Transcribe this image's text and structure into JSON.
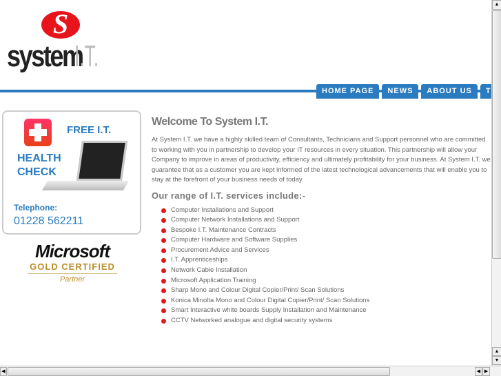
{
  "logo": {
    "mark": "S",
    "word": "system",
    "suffix": "I.T."
  },
  "nav": {
    "items": [
      {
        "label": "HOME PAGE"
      },
      {
        "label": "NEWS"
      },
      {
        "label": "ABOUT US"
      },
      {
        "label": "TEST"
      }
    ]
  },
  "promo": {
    "free": "FREE I.T.",
    "health": "HEALTH",
    "check": "CHECK",
    "telephone_label": "Telephone:",
    "telephone": "01228 562211"
  },
  "partner": {
    "brand": "Microsoft",
    "level": "GOLD CERTIFIED",
    "type": "Partner"
  },
  "main": {
    "title": "Welcome To System I.T.",
    "intro": "At System I.T. we have a highly skilled team of Consultants, Technicians and Support personnel who are committed to working with you in partnership to develop your IT resources in every situation.  This partnership will allow your Company to improve in areas of productivity, efficiency and ultimately profitability for your business. At System I.T. we guarantee that as a customer you are kept informed of the latest technological advancements that will enable you to stay at the forefront of your business needs of today.",
    "services_heading": "Our range of I.T. services include:-",
    "services": [
      "Computer Installations and Support",
      "Computer Network Installations and Support",
      "Bespoke I.T. Maintenance Contracts",
      "Computer Hardware and Software Supplies",
      "Procurement Advice and Services",
      "I.T. Apprenticeships",
      "Network Cable Installation",
      "Microsoft Application Training",
      "Sharp Mono and Colour Digital Copier/Print/ Scan Solutions",
      "Konica Minolta  Mono and Colour Digital Copier/Print/ Scan Solutions",
      "Smart Interactive white boards Supply Installation and Maintenance",
      "CCTV Networked analogue and digital security systems"
    ]
  },
  "colors": {
    "brand_blue": "#2a7bbf",
    "brand_red": "#e8141c",
    "gold": "#b8902a"
  }
}
